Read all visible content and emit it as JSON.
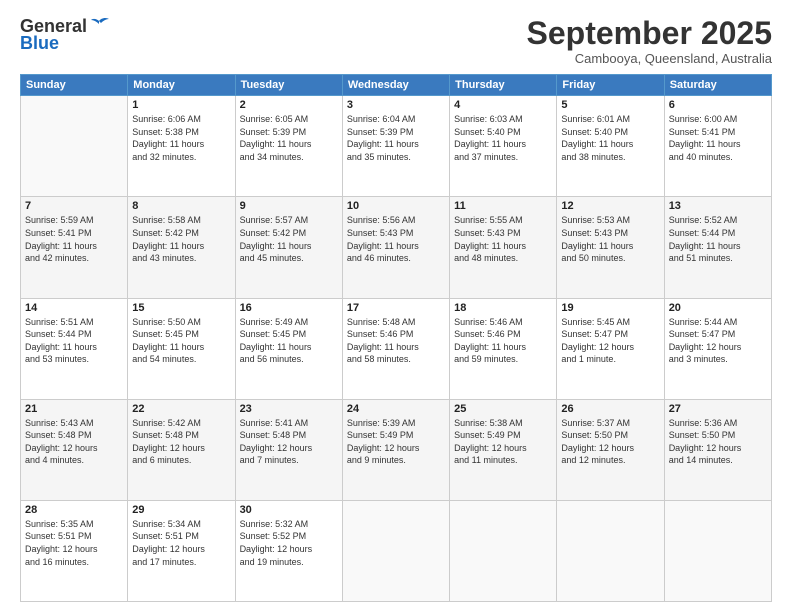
{
  "header": {
    "logo_general": "General",
    "logo_blue": "Blue",
    "month": "September 2025",
    "location": "Cambooya, Queensland, Australia"
  },
  "days_of_week": [
    "Sunday",
    "Monday",
    "Tuesday",
    "Wednesday",
    "Thursday",
    "Friday",
    "Saturday"
  ],
  "weeks": [
    [
      {
        "day": "",
        "info": ""
      },
      {
        "day": "1",
        "info": "Sunrise: 6:06 AM\nSunset: 5:38 PM\nDaylight: 11 hours\nand 32 minutes."
      },
      {
        "day": "2",
        "info": "Sunrise: 6:05 AM\nSunset: 5:39 PM\nDaylight: 11 hours\nand 34 minutes."
      },
      {
        "day": "3",
        "info": "Sunrise: 6:04 AM\nSunset: 5:39 PM\nDaylight: 11 hours\nand 35 minutes."
      },
      {
        "day": "4",
        "info": "Sunrise: 6:03 AM\nSunset: 5:40 PM\nDaylight: 11 hours\nand 37 minutes."
      },
      {
        "day": "5",
        "info": "Sunrise: 6:01 AM\nSunset: 5:40 PM\nDaylight: 11 hours\nand 38 minutes."
      },
      {
        "day": "6",
        "info": "Sunrise: 6:00 AM\nSunset: 5:41 PM\nDaylight: 11 hours\nand 40 minutes."
      }
    ],
    [
      {
        "day": "7",
        "info": "Sunrise: 5:59 AM\nSunset: 5:41 PM\nDaylight: 11 hours\nand 42 minutes."
      },
      {
        "day": "8",
        "info": "Sunrise: 5:58 AM\nSunset: 5:42 PM\nDaylight: 11 hours\nand 43 minutes."
      },
      {
        "day": "9",
        "info": "Sunrise: 5:57 AM\nSunset: 5:42 PM\nDaylight: 11 hours\nand 45 minutes."
      },
      {
        "day": "10",
        "info": "Sunrise: 5:56 AM\nSunset: 5:43 PM\nDaylight: 11 hours\nand 46 minutes."
      },
      {
        "day": "11",
        "info": "Sunrise: 5:55 AM\nSunset: 5:43 PM\nDaylight: 11 hours\nand 48 minutes."
      },
      {
        "day": "12",
        "info": "Sunrise: 5:53 AM\nSunset: 5:43 PM\nDaylight: 11 hours\nand 50 minutes."
      },
      {
        "day": "13",
        "info": "Sunrise: 5:52 AM\nSunset: 5:44 PM\nDaylight: 11 hours\nand 51 minutes."
      }
    ],
    [
      {
        "day": "14",
        "info": "Sunrise: 5:51 AM\nSunset: 5:44 PM\nDaylight: 11 hours\nand 53 minutes."
      },
      {
        "day": "15",
        "info": "Sunrise: 5:50 AM\nSunset: 5:45 PM\nDaylight: 11 hours\nand 54 minutes."
      },
      {
        "day": "16",
        "info": "Sunrise: 5:49 AM\nSunset: 5:45 PM\nDaylight: 11 hours\nand 56 minutes."
      },
      {
        "day": "17",
        "info": "Sunrise: 5:48 AM\nSunset: 5:46 PM\nDaylight: 11 hours\nand 58 minutes."
      },
      {
        "day": "18",
        "info": "Sunrise: 5:46 AM\nSunset: 5:46 PM\nDaylight: 11 hours\nand 59 minutes."
      },
      {
        "day": "19",
        "info": "Sunrise: 5:45 AM\nSunset: 5:47 PM\nDaylight: 12 hours\nand 1 minute."
      },
      {
        "day": "20",
        "info": "Sunrise: 5:44 AM\nSunset: 5:47 PM\nDaylight: 12 hours\nand 3 minutes."
      }
    ],
    [
      {
        "day": "21",
        "info": "Sunrise: 5:43 AM\nSunset: 5:48 PM\nDaylight: 12 hours\nand 4 minutes."
      },
      {
        "day": "22",
        "info": "Sunrise: 5:42 AM\nSunset: 5:48 PM\nDaylight: 12 hours\nand 6 minutes."
      },
      {
        "day": "23",
        "info": "Sunrise: 5:41 AM\nSunset: 5:48 PM\nDaylight: 12 hours\nand 7 minutes."
      },
      {
        "day": "24",
        "info": "Sunrise: 5:39 AM\nSunset: 5:49 PM\nDaylight: 12 hours\nand 9 minutes."
      },
      {
        "day": "25",
        "info": "Sunrise: 5:38 AM\nSunset: 5:49 PM\nDaylight: 12 hours\nand 11 minutes."
      },
      {
        "day": "26",
        "info": "Sunrise: 5:37 AM\nSunset: 5:50 PM\nDaylight: 12 hours\nand 12 minutes."
      },
      {
        "day": "27",
        "info": "Sunrise: 5:36 AM\nSunset: 5:50 PM\nDaylight: 12 hours\nand 14 minutes."
      }
    ],
    [
      {
        "day": "28",
        "info": "Sunrise: 5:35 AM\nSunset: 5:51 PM\nDaylight: 12 hours\nand 16 minutes."
      },
      {
        "day": "29",
        "info": "Sunrise: 5:34 AM\nSunset: 5:51 PM\nDaylight: 12 hours\nand 17 minutes."
      },
      {
        "day": "30",
        "info": "Sunrise: 5:32 AM\nSunset: 5:52 PM\nDaylight: 12 hours\nand 19 minutes."
      },
      {
        "day": "",
        "info": ""
      },
      {
        "day": "",
        "info": ""
      },
      {
        "day": "",
        "info": ""
      },
      {
        "day": "",
        "info": ""
      }
    ]
  ]
}
